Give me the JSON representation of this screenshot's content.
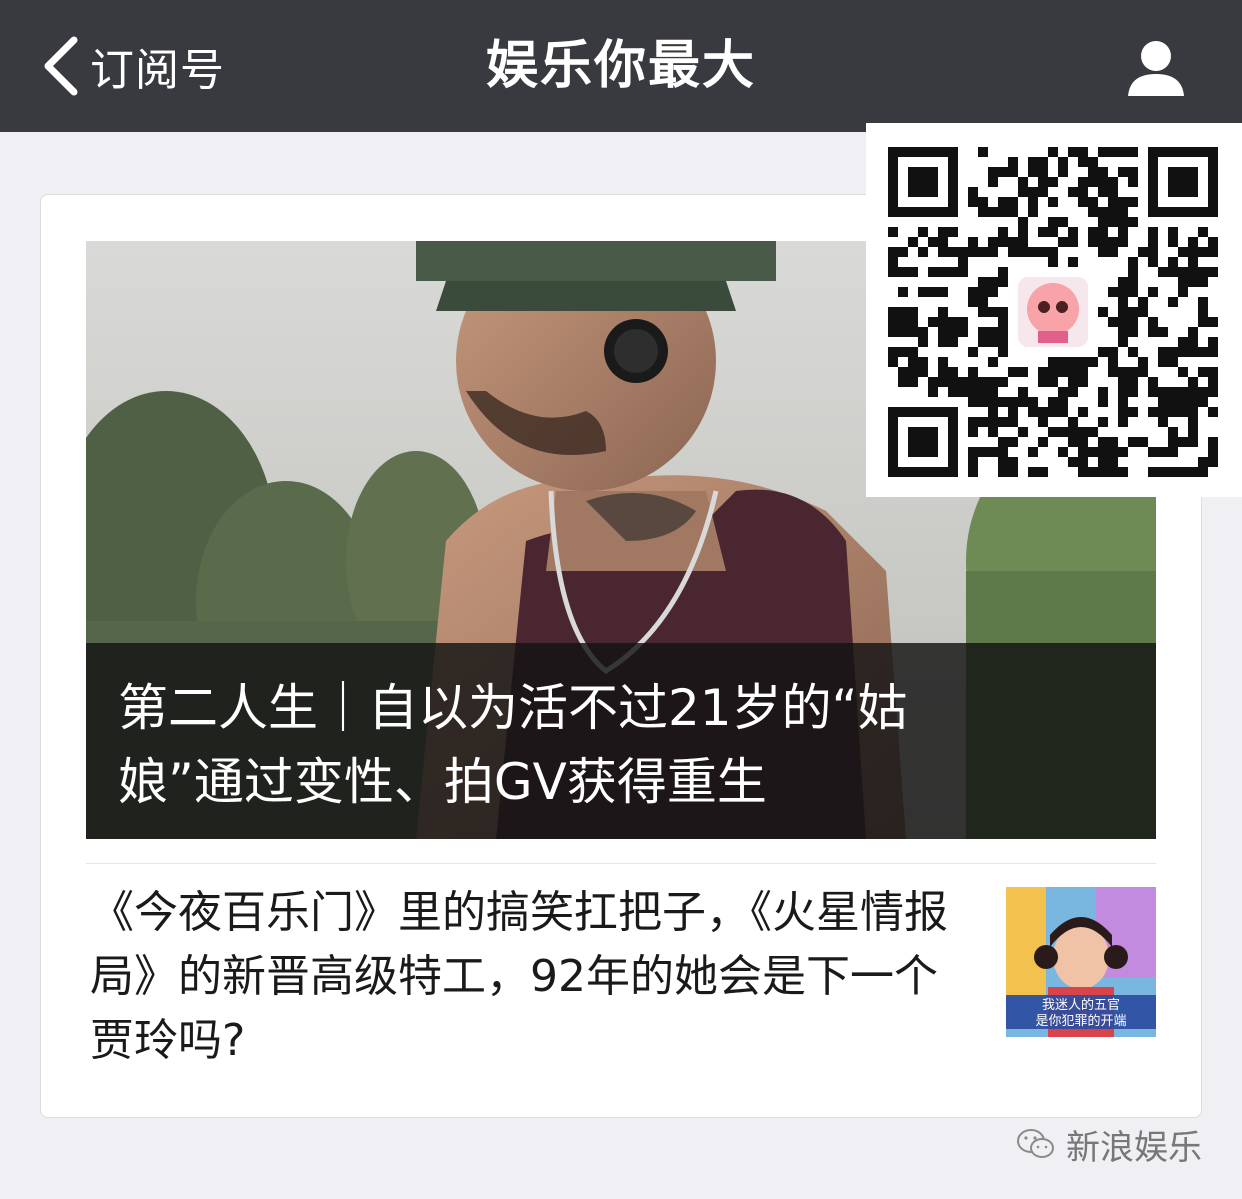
{
  "navbar": {
    "back_label": "订阅号",
    "title": "娱乐你最大",
    "back_icon": "chevron-left-icon",
    "profile_icon": "person-icon"
  },
  "hero_article": {
    "title": "第二人生｜自以为活不过21岁的“姑娘”通过变性、拍GV获得重生"
  },
  "article": {
    "title": "《今夜百乐门》里的搞笑扛把子，《火星情报局》的新晋高级特工，92年的她会是下一个贾玲吗?",
    "thumbnail_caption_line1": "我迷人的五官",
    "thumbnail_caption_line2": "是你犯罪的开端"
  },
  "watermark": {
    "text": "新浪娱乐",
    "icon": "wechat-icon"
  },
  "colors": {
    "navbar_bg": "#393a3f",
    "page_bg": "#efeff4",
    "caption_bg": "#141414"
  }
}
